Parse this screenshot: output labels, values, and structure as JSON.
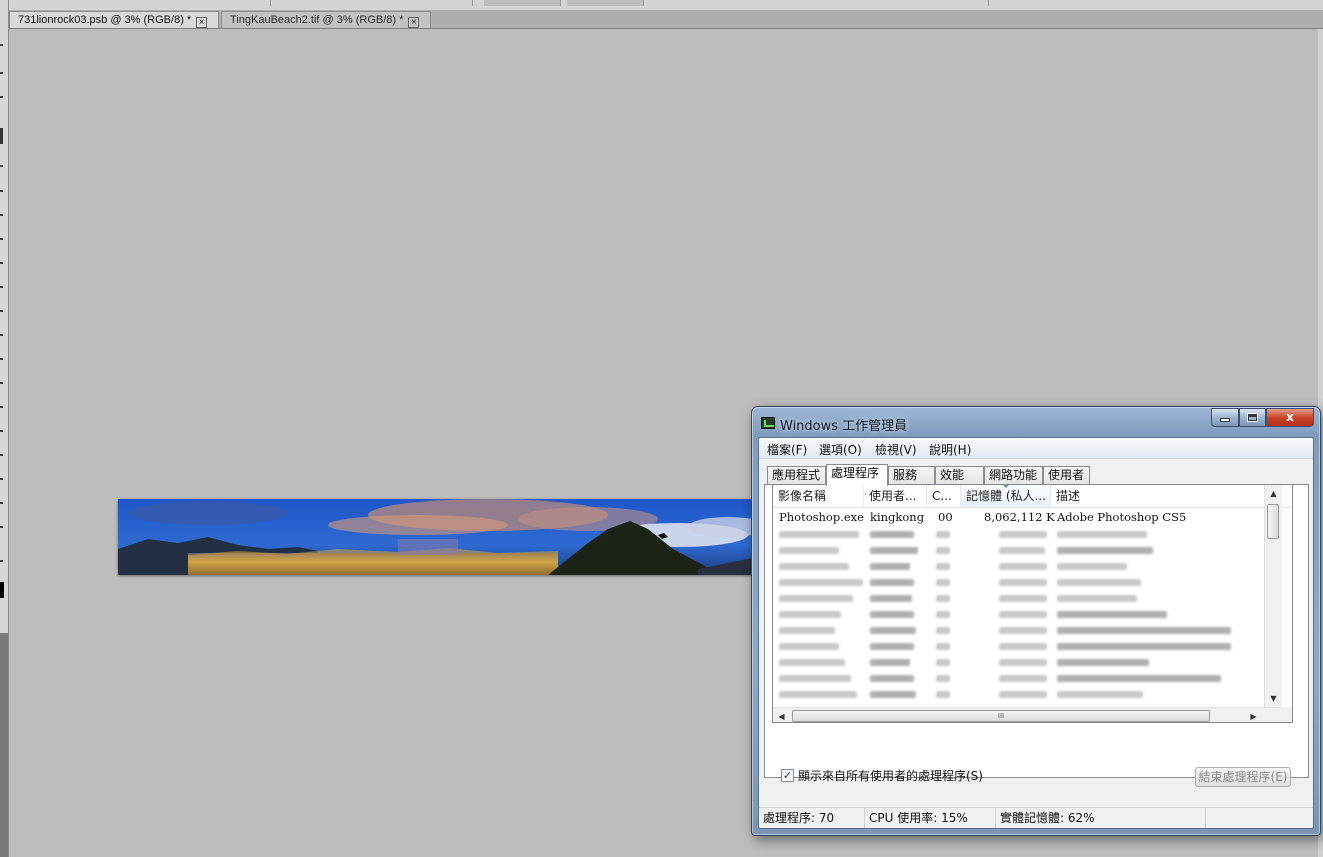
{
  "photoshop": {
    "tabs": [
      {
        "label": "731lionrock03.psb @ 3% (RGB/8) *",
        "close": "×"
      },
      {
        "label": "TingKauBeach2.tif @ 3% (RGB/8) *",
        "close": "×"
      }
    ]
  },
  "taskmanager": {
    "title": "Windows 工作管理員",
    "controls": {
      "minimize": "",
      "maximize": "",
      "close": "x"
    },
    "menu": [
      "檔案(F)",
      "選項(O)",
      "檢視(V)",
      "說明(H)"
    ],
    "tabs": [
      "應用程式",
      "處理程序",
      "服務",
      "效能",
      "網路功能",
      "使用者"
    ],
    "active_tab": "處理程序",
    "columns": [
      "影像名稱",
      "使用者...",
      "C...",
      "記憶體 (私人...",
      "描述"
    ],
    "sorted_column": "記憶體 (私人...",
    "first_row": {
      "image": "Photoshop.exe",
      "user": "kingkong",
      "cpu": "00",
      "memory": "8,062,112 K",
      "description": "Adobe Photoshop CS5"
    },
    "show_all_label": "顯示來自所有使用者的處理程序(S)",
    "show_all_checked": "✓",
    "end_process_label": "結束處理程序(E)",
    "status": {
      "processes": "處理程序: 70",
      "cpu": "CPU 使用率: 15%",
      "memory": "實體記憶體: 62%"
    },
    "scroll": {
      "up": "▲",
      "down": "▼",
      "left": "◀",
      "right": "▶",
      "grip": "III"
    }
  }
}
